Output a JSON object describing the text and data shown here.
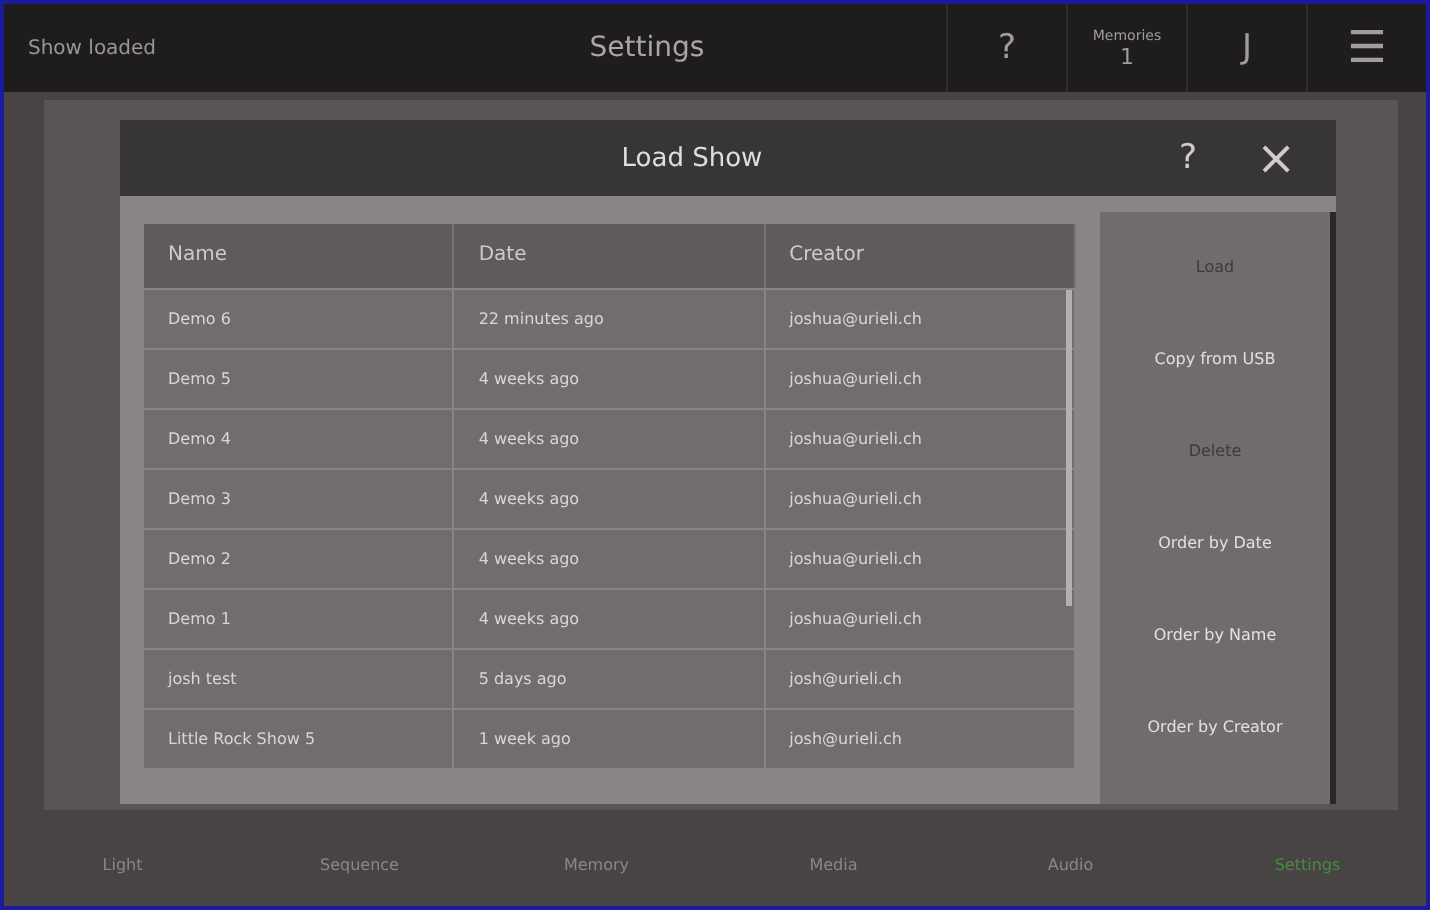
{
  "top_bar": {
    "status": "Show loaded",
    "title": "Settings",
    "help": "?",
    "memories": {
      "label": "Memories",
      "count": "1"
    },
    "user": "J",
    "menu": "☰"
  },
  "dialog": {
    "title": "Load Show",
    "help": "?",
    "close": "×",
    "table": {
      "columns": [
        "Name",
        "Date",
        "Creator"
      ],
      "rows": [
        {
          "cells": [
            "Demo 6",
            "22 minutes ago",
            "joshua@urieli.ch"
          ]
        },
        {
          "cells": [
            "Demo 5",
            "4 weeks ago",
            "joshua@urieli.ch"
          ]
        },
        {
          "cells": [
            "Demo 4",
            "4 weeks ago",
            "joshua@urieli.ch"
          ]
        },
        {
          "cells": [
            "Demo 3",
            "4 weeks ago",
            "joshua@urieli.ch"
          ]
        },
        {
          "cells": [
            "Demo 2",
            "4 weeks ago",
            "joshua@urieli.ch"
          ]
        },
        {
          "cells": [
            "Demo 1",
            "4 weeks ago",
            "joshua@urieli.ch"
          ]
        },
        {
          "cells": [
            "josh test",
            "5 days ago",
            "josh@urieli.ch"
          ]
        },
        {
          "cells": [
            "Little Rock Show 5",
            "1 week ago",
            "josh@urieli.ch"
          ]
        }
      ]
    },
    "actions": [
      {
        "label": "Load",
        "disabled": true
      },
      {
        "label": "Copy from USB",
        "disabled": false
      },
      {
        "label": "Delete",
        "disabled": true
      },
      {
        "label": "Order by Date",
        "disabled": false
      },
      {
        "label": "Order by Name",
        "disabled": false
      },
      {
        "label": "Order by Creator",
        "disabled": false
      }
    ]
  },
  "nav": [
    {
      "label": "Light",
      "selected": false
    },
    {
      "label": "Sequence",
      "selected": false
    },
    {
      "label": "Memory",
      "selected": false
    },
    {
      "label": "Media",
      "selected": false
    },
    {
      "label": "Audio",
      "selected": false
    },
    {
      "label": "Settings",
      "selected": true
    }
  ]
}
